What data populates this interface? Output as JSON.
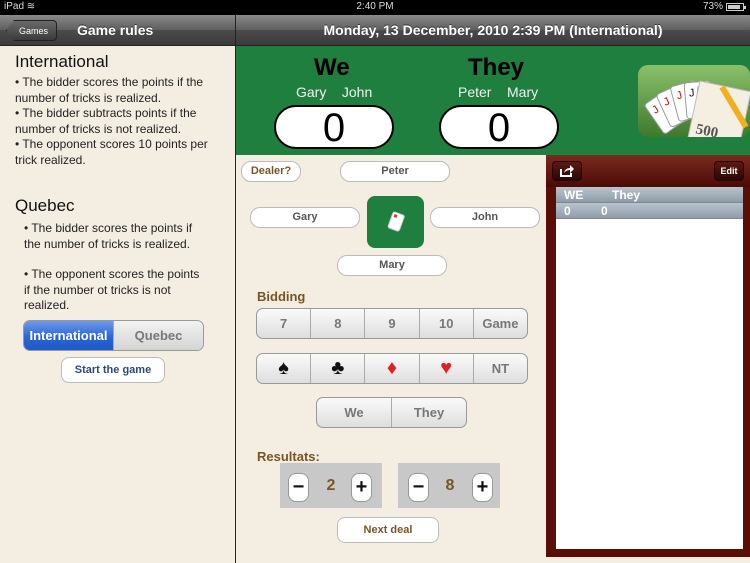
{
  "status_bar": {
    "device": "iPad",
    "time": "2:40 PM",
    "battery": "73%",
    "battery_level": 0.73
  },
  "nav_left": {
    "back_label": "Games",
    "title": "Game rules"
  },
  "nav_right": {
    "title": "Monday, 13 December, 2010 2:39 PM (International)"
  },
  "rules": {
    "international": {
      "title": "International",
      "lines": [
        "• The bidder scores the points if the",
        "number of tricks is realized.",
        "• The bidder subtracts points if the",
        "number of tricks is not realized.",
        "• The opponent scores 10 points per",
        "trick realized."
      ]
    },
    "quebec": {
      "title": "Quebec",
      "para1": [
        "• The bidder scores the points if",
        "the number of tricks is realized."
      ],
      "para2": [
        "• The opponent scores the points",
        "if the number ot tricks is not",
        "realized."
      ]
    },
    "mode_options": [
      "International",
      "Quebec"
    ],
    "mode_selected": "International",
    "start_label": "Start the game"
  },
  "scoreboard": {
    "we": {
      "label": "We",
      "players": "Gary    John",
      "score": "0"
    },
    "they": {
      "label": "They",
      "players": "Peter    Mary",
      "score": "0"
    },
    "app_icon_text": "500"
  },
  "table": {
    "dealer_label": "Dealer?",
    "north": "Peter",
    "west": "Gary",
    "east": "John",
    "south": "Mary"
  },
  "bidding": {
    "label": "Bidding",
    "tricks": [
      "7",
      "8",
      "9",
      "10",
      "Game"
    ],
    "suits": [
      {
        "name": "spade",
        "glyph": "♠",
        "color": "#111111"
      },
      {
        "name": "club",
        "glyph": "♣",
        "color": "#111111"
      },
      {
        "name": "diamond",
        "glyph": "♦",
        "color": "#e02020"
      },
      {
        "name": "heart",
        "glyph": "♥",
        "color": "#e02020"
      },
      {
        "name": "no-trump",
        "glyph": "NT",
        "color": "#777777"
      }
    ],
    "teams": [
      "We",
      "They"
    ]
  },
  "results": {
    "label": "Resultats:",
    "we_value": "2",
    "they_value": "8",
    "minus": "−",
    "plus": "+",
    "next_label": "Next deal"
  },
  "history": {
    "edit_label": "Edit",
    "columns": [
      "WE",
      "They"
    ],
    "rows": [
      [
        "0",
        "0"
      ]
    ]
  },
  "colors": {
    "green": "#1f7f3e",
    "cream": "#f3eee1",
    "maroon": "#5a0f06",
    "brown_text": "#7a5524",
    "accent_blue": "#2c66d6"
  }
}
